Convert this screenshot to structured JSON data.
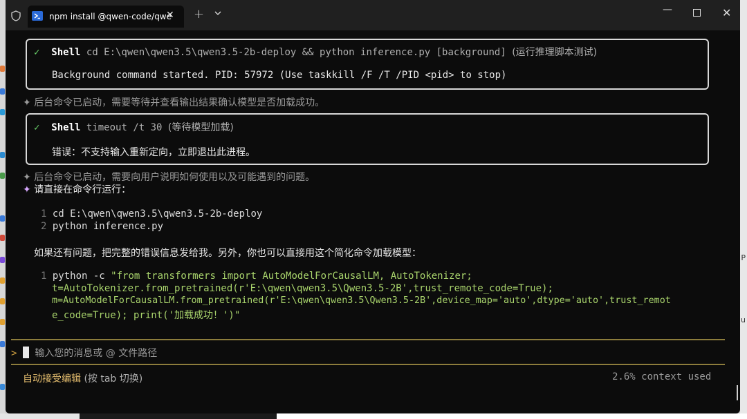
{
  "tab": {
    "title": "npm install @qwen-code/qwe",
    "close": "✕",
    "new_tab": "+"
  },
  "window_controls": {
    "minimize": "—",
    "close": "✕"
  },
  "desktop_right": [
    "P",
    "u"
  ],
  "terminal": {
    "box1": {
      "check": "✓",
      "tool": "Shell",
      "command": "cd E:\\qwen\\qwen3.5\\qwen3.5-2b-deploy && python inference.py [background]",
      "desc": "(运行推理脚本测试)",
      "output": "Background command started. PID: 57972 (Use taskkill /F /T /PID <pid> to stop)"
    },
    "thought1": {
      "star": "✦",
      "text": "后台命令已启动，需要等待并查看输出结果确认模型是否加载成功。"
    },
    "box2": {
      "check": "✓",
      "tool": "Shell",
      "command": "timeout /t 30",
      "desc": "(等待模型加载)",
      "output": "错误：不支持输入重新定向，立即退出此进程。"
    },
    "thought2": {
      "star": "✦",
      "text": "后台命令已启动，需要向用户说明如何使用以及可能遇到的问题。"
    },
    "answer": {
      "star": "✦",
      "text": "请直接在命令行运行："
    },
    "code1": [
      {
        "num": "1",
        "text": "cd E:\\qwen\\qwen3.5\\qwen3.5-2b-deploy"
      },
      {
        "num": "2",
        "text": "python inference.py"
      }
    ],
    "para": "如果还有问题，把完整的错误信息发给我。另外，你也可以直接用这个简化命令加载模型：",
    "code2": {
      "num": "1",
      "prefix": "python -c ",
      "l1": "\"from transformers import AutoModelForCausalLM, AutoTokenizer;",
      "l2": "t=AutoTokenizer.from_pretrained(r'E:\\qwen\\qwen3.5\\Qwen3.5-2B',trust_remote_code=True);",
      "l3": "m=AutoModelForCausalLM.from_pretrained(r'E:\\qwen\\qwen3.5\\Qwen3.5-2B',device_map='auto',dtype='auto',trust_remot",
      "l4": "e_code=True); print('加载成功！')\""
    },
    "input": {
      "prompt": ">",
      "placeholder": "输入您的消息或 @ 文件路径"
    },
    "status": {
      "mode": "自动接受编辑",
      "hint": "(按 tab 切换)",
      "context": "2.6% context used"
    }
  },
  "colors": {
    "check": "#6bd26b",
    "separator": "#8d7d3c",
    "code_string": "#a9d46c",
    "mode": "#e8c070"
  }
}
